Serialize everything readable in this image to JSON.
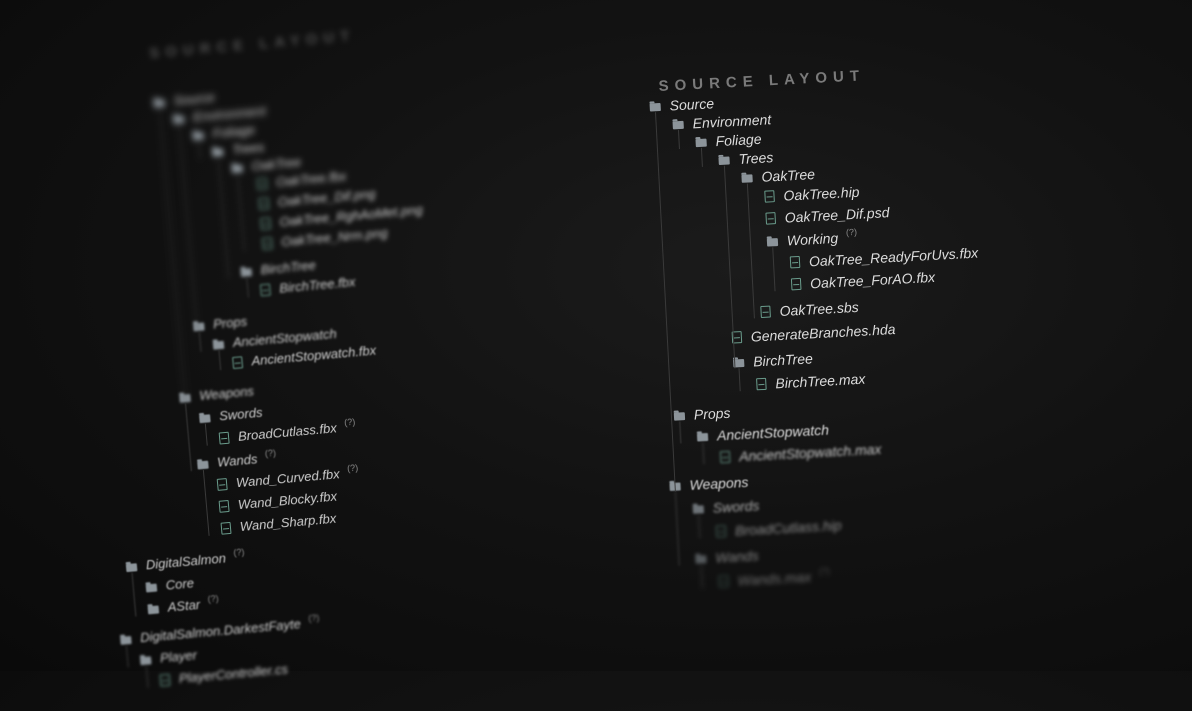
{
  "left_panel": {
    "title": "SOURCE LAYOUT",
    "nodes": [
      {
        "label": "Source",
        "type": "folder"
      },
      {
        "label": "Environment",
        "type": "folder"
      },
      {
        "label": "Foliage",
        "type": "folder"
      },
      {
        "label": "Trees",
        "type": "folder"
      },
      {
        "label": "OakTree",
        "type": "folder"
      },
      {
        "label": "OakTree.fbx",
        "type": "file"
      },
      {
        "label": "OakTree_Dif.png",
        "type": "file"
      },
      {
        "label": "OakTree_RghAoMet.png",
        "type": "file"
      },
      {
        "label": "OakTree_Nrm.png",
        "type": "file"
      },
      {
        "label": "BirchTree",
        "type": "folder"
      },
      {
        "label": "BirchTree.fbx",
        "type": "file"
      },
      {
        "label": "Props",
        "type": "folder"
      },
      {
        "label": "AncientStopwatch",
        "type": "folder"
      },
      {
        "label": "AncientStopwatch.fbx",
        "type": "file"
      },
      {
        "label": "Weapons",
        "type": "folder"
      },
      {
        "label": "Swords",
        "type": "folder"
      },
      {
        "label": "BroadCutlass.fbx",
        "type": "file",
        "badge": "(?)"
      },
      {
        "label": "Wands",
        "type": "folder",
        "badge": "(?)"
      },
      {
        "label": "Wand_Curved.fbx",
        "type": "file",
        "badge": "(?)"
      },
      {
        "label": "Wand_Blocky.fbx",
        "type": "file"
      },
      {
        "label": "Wand_Sharp.fbx",
        "type": "file"
      },
      {
        "label": "DigitalSalmon",
        "type": "folder",
        "badge": "(?)"
      },
      {
        "label": "Core",
        "type": "folder"
      },
      {
        "label": "AStar",
        "type": "folder",
        "badge": "(?)"
      },
      {
        "label": "DigitalSalmon.DarkestFayte",
        "type": "folder",
        "badge": "(?)"
      },
      {
        "label": "Player",
        "type": "folder"
      },
      {
        "label": "PlayerController.cs",
        "type": "file"
      }
    ]
  },
  "right_panel": {
    "title": "SOURCE LAYOUT",
    "nodes": [
      {
        "label": "Source",
        "type": "folder"
      },
      {
        "label": "Environment",
        "type": "folder"
      },
      {
        "label": "Foliage",
        "type": "folder"
      },
      {
        "label": "Trees",
        "type": "folder"
      },
      {
        "label": "OakTree",
        "type": "folder"
      },
      {
        "label": "OakTree.hip",
        "type": "file"
      },
      {
        "label": "OakTree_Dif.psd",
        "type": "file"
      },
      {
        "label": "Working",
        "type": "folder",
        "badge": "(?)"
      },
      {
        "label": "OakTree_ReadyForUvs.fbx",
        "type": "file"
      },
      {
        "label": "OakTree_ForAO.fbx",
        "type": "file"
      },
      {
        "label": "OakTree.sbs",
        "type": "file"
      },
      {
        "label": "GenerateBranches.hda",
        "type": "file"
      },
      {
        "label": "BirchTree",
        "type": "folder"
      },
      {
        "label": "BirchTree.max",
        "type": "file"
      },
      {
        "label": "Props",
        "type": "folder"
      },
      {
        "label": "AncientStopwatch",
        "type": "folder"
      },
      {
        "label": "AncientStopwatch.max",
        "type": "file"
      },
      {
        "label": "Weapons",
        "type": "folder"
      },
      {
        "label": "Swords",
        "type": "folder"
      },
      {
        "label": "BroadCutlass.hip",
        "type": "file"
      },
      {
        "label": "Wands",
        "type": "folder"
      },
      {
        "label": "Wands.max",
        "type": "file",
        "badge": "(?)"
      }
    ]
  }
}
